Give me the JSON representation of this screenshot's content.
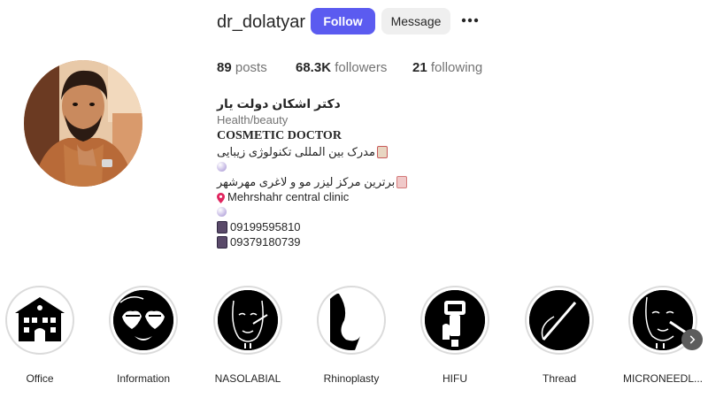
{
  "profile": {
    "username": "dr_dolatyar",
    "follow_label": "Follow",
    "message_label": "Message",
    "more_icon": "more-options-icon"
  },
  "stats": {
    "posts_count": "89",
    "posts_label": "posts",
    "followers_count": "68.3K",
    "followers_label": "followers",
    "following_count": "21",
    "following_label": "following"
  },
  "bio": {
    "display_name": "دکتر اشکان دولت یار",
    "category": "Health/beauty",
    "heading": "COSMETIC DOCTOR",
    "line1": "مدرک بین المللی تکنولوژی زیبایی",
    "line2": "برترین مرکز لیزر مو و لاغری مهرشهر",
    "location": "Mehrshahr central clinic",
    "phone1": "09199595810",
    "phone2": "09379180739"
  },
  "highlights": [
    {
      "label": "Office",
      "icon": "building-icon"
    },
    {
      "label": "Information",
      "icon": "heart-sunglasses-face-icon"
    },
    {
      "label": "NASOLABIAL",
      "icon": "face-injection-icon"
    },
    {
      "label": "Rhinoplasty",
      "icon": "nose-profile-icon"
    },
    {
      "label": "HIFU",
      "icon": "hifu-device-icon"
    },
    {
      "label": "Thread",
      "icon": "thread-needle-icon"
    },
    {
      "label": "MICRONEEDL...",
      "icon": "microneedling-face-icon"
    }
  ],
  "colors": {
    "follow_button": "#5b5bf0",
    "message_button": "#efefef",
    "muted_text": "#737373"
  }
}
